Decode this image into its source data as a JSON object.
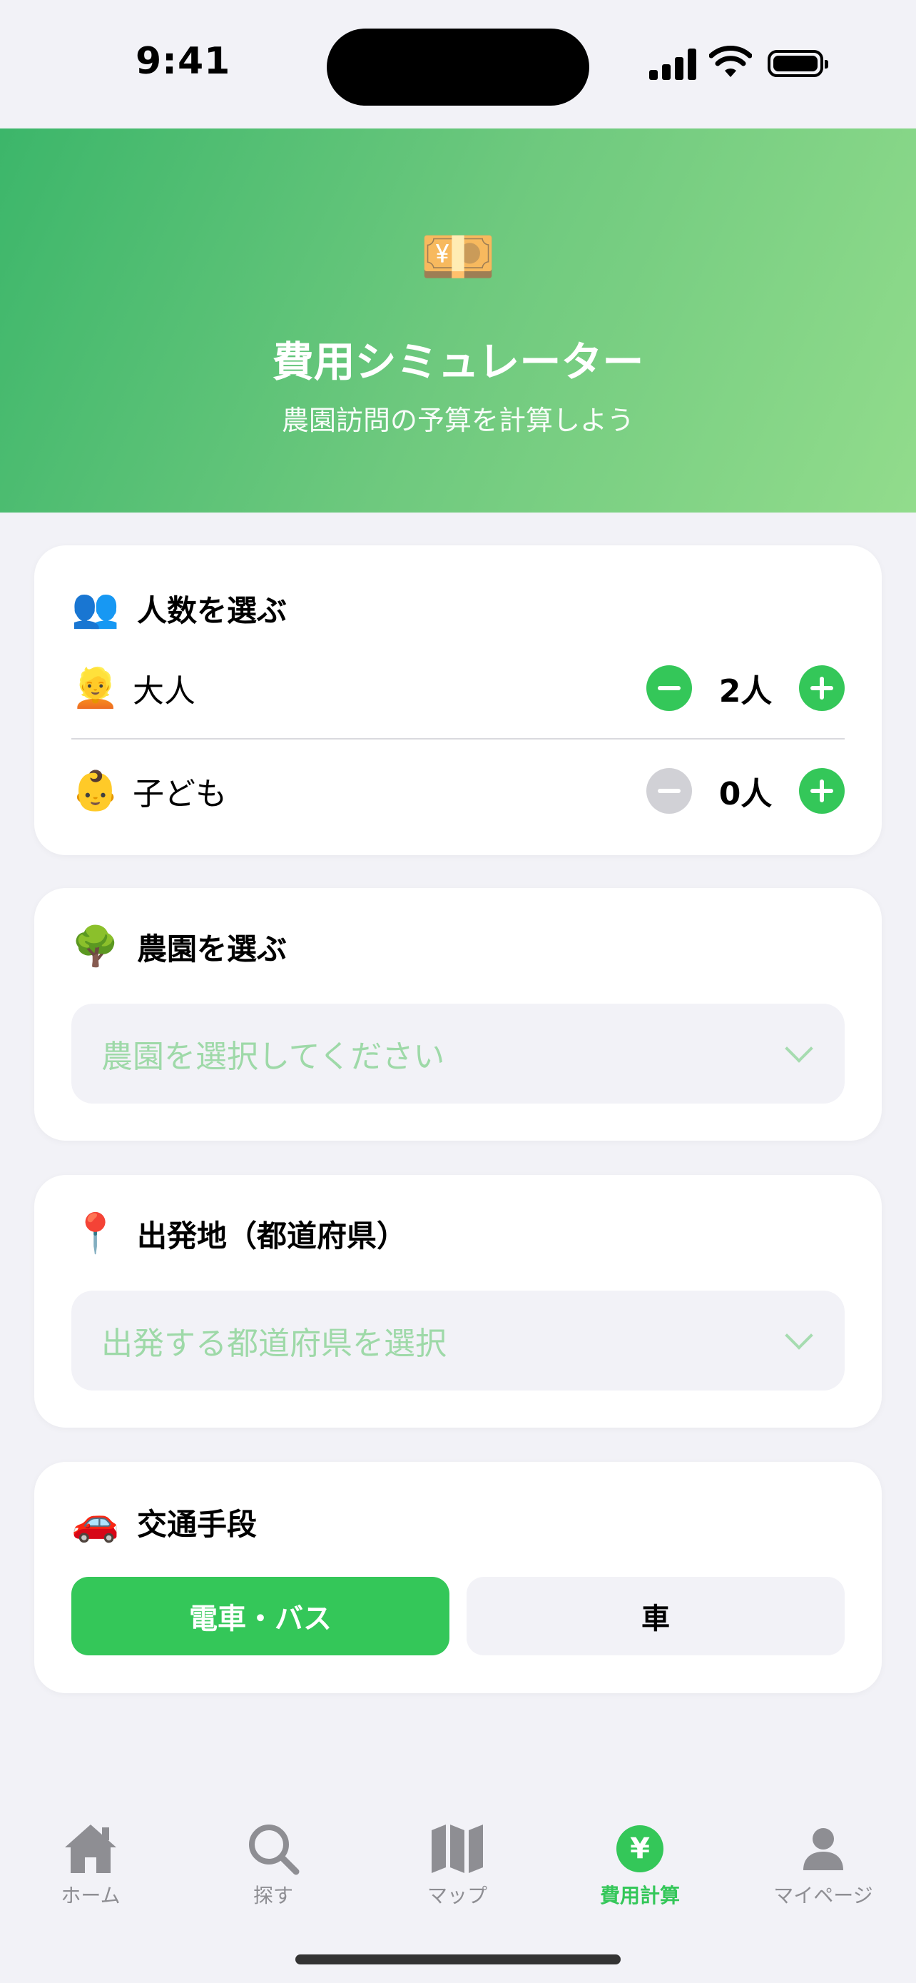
{
  "status_bar": {
    "time": "9:41"
  },
  "header": {
    "emoji": "💴",
    "title": "費用シミュレーター",
    "subtitle": "農園訪問の予算を計算しよう"
  },
  "people": {
    "emoji": "👥",
    "title": "人数を選ぶ",
    "adult": {
      "emoji": "👱",
      "label": "大人",
      "count": "2人"
    },
    "child": {
      "emoji": "👶",
      "label": "子ども",
      "count": "0人"
    }
  },
  "farm": {
    "emoji": "🌳",
    "title": "農園を選ぶ",
    "placeholder": "農園を選択してください"
  },
  "departure": {
    "emoji": "📍",
    "title": "出発地（都道府県）",
    "placeholder": "出発する都道府県を選択"
  },
  "transport": {
    "emoji": "🚗",
    "title": "交通手段",
    "options": [
      "電車・バス",
      "車"
    ],
    "selected": "電車・バス"
  },
  "tabbar": {
    "items": [
      {
        "label": "ホーム",
        "icon": "house-icon"
      },
      {
        "label": "探す",
        "icon": "search-icon"
      },
      {
        "label": "マップ",
        "icon": "map-icon"
      },
      {
        "label": "費用計算",
        "icon": "yen-icon"
      },
      {
        "label": "マイページ",
        "icon": "person-icon"
      }
    ],
    "active": "費用計算",
    "yen_symbol": "¥"
  },
  "colors": {
    "accent": "#34c759",
    "header_gradient_start": "#3cb66a",
    "header_gradient_end": "#92dc8c",
    "background": "#f2f2f7",
    "placeholder": "#9ed9a8",
    "disabled": "#d1d1d6"
  }
}
